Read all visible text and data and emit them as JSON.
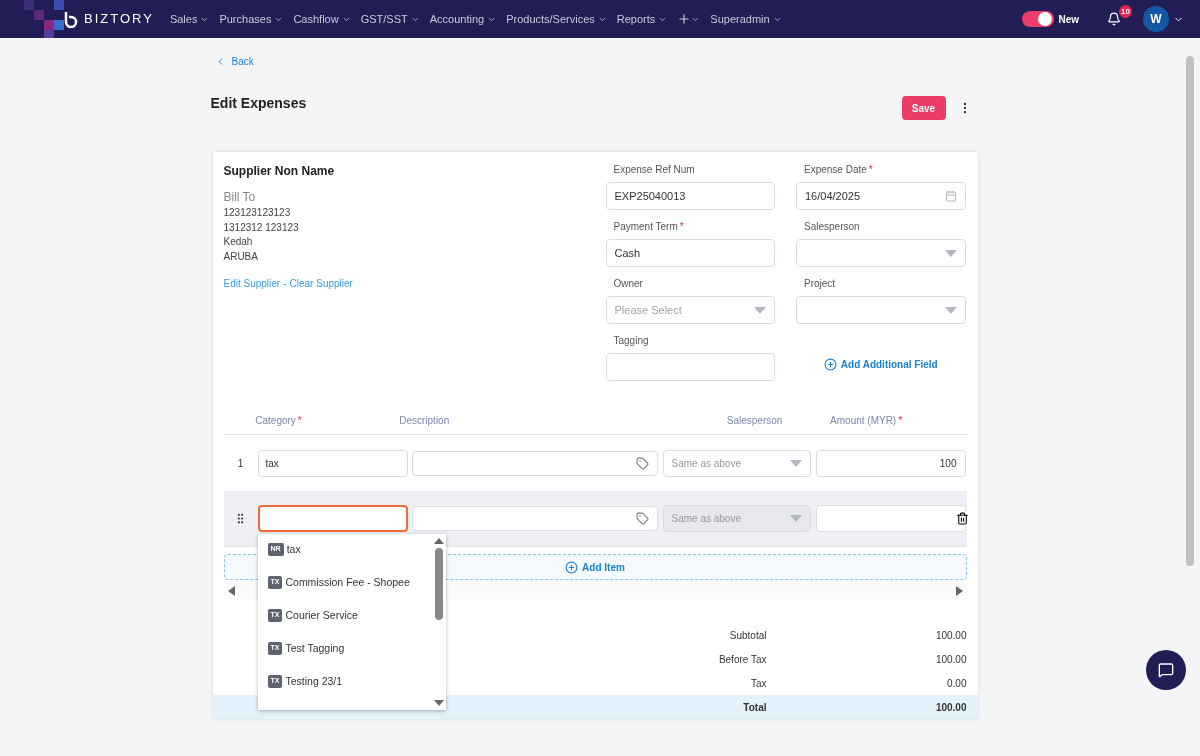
{
  "nav": {
    "brand": "BIZTORY",
    "menus": [
      {
        "label": "Sales"
      },
      {
        "label": "Purchases"
      },
      {
        "label": "Cashflow"
      },
      {
        "label": "GST/SST"
      },
      {
        "label": "Accounting"
      },
      {
        "label": "Products/Services"
      },
      {
        "label": "Reports"
      },
      {
        "kind": "plus"
      },
      {
        "label": "Superadmin"
      }
    ],
    "toggle": {
      "label": "New",
      "on": true
    },
    "notifications": {
      "count": "10"
    },
    "avatar": {
      "initial": "W"
    }
  },
  "page": {
    "back": "Back",
    "title": "Edit Expenses",
    "save": "Save"
  },
  "supplier": {
    "name": "Supplier Non Name",
    "bill_to": "Bill To",
    "address": [
      "123123123123",
      "1312312 123123",
      "Kedah",
      "ARUBA"
    ],
    "edit_link": "Edit Supplier",
    "separator": "-",
    "clear_link": "Clear Supplier"
  },
  "fields": [
    {
      "label": "Expense Ref Num",
      "required": false,
      "kind": "text",
      "value": "EXP25040013"
    },
    {
      "label": "Expense Date",
      "required": true,
      "kind": "date",
      "value": "16/04/2025"
    },
    {
      "label": "Payment Term",
      "required": true,
      "kind": "text",
      "value": "Cash"
    },
    {
      "label": "Salesperson",
      "required": false,
      "kind": "select"
    },
    {
      "label": "Owner",
      "required": false,
      "kind": "select",
      "placeholder": "Please Select"
    },
    {
      "label": "Project",
      "required": false,
      "kind": "select"
    },
    {
      "label": "Tagging",
      "required": false,
      "kind": "text"
    }
  ],
  "add_field": "Add Additional Field",
  "required_mark": "*",
  "items": {
    "columns": [
      {
        "label": "Category",
        "required": true
      },
      {
        "label": "Description",
        "required": false
      },
      {
        "label": "Salesperson",
        "required": false
      },
      {
        "label": "Amount (MYR)",
        "required": true
      }
    ],
    "rows": [
      {
        "number": "1",
        "category": "tax",
        "salesperson_placeholder": "Same as above",
        "salesperson_disabled": false,
        "amount": "100",
        "active": false
      },
      {
        "salesperson_placeholder": "Same as above",
        "salesperson_disabled": true,
        "active": true
      }
    ],
    "dropdown": [
      {
        "code": "NR",
        "label": "tax"
      },
      {
        "code": "TX",
        "label": "Commission Fee - Shopee"
      },
      {
        "code": "TX",
        "label": "Courier Service"
      },
      {
        "code": "TX",
        "label": "Test Tagging"
      },
      {
        "code": "TX",
        "label": "Testing 23/1"
      }
    ],
    "add_item": "Add Item"
  },
  "totals": [
    {
      "label": "Subtotal",
      "value": "100.00",
      "highlight": false
    },
    {
      "label": "Before Tax",
      "value": "100.00",
      "highlight": false
    },
    {
      "label": "Tax",
      "value": "0.00",
      "highlight": false
    },
    {
      "label": "Total",
      "value": "100.00",
      "highlight": true
    }
  ]
}
